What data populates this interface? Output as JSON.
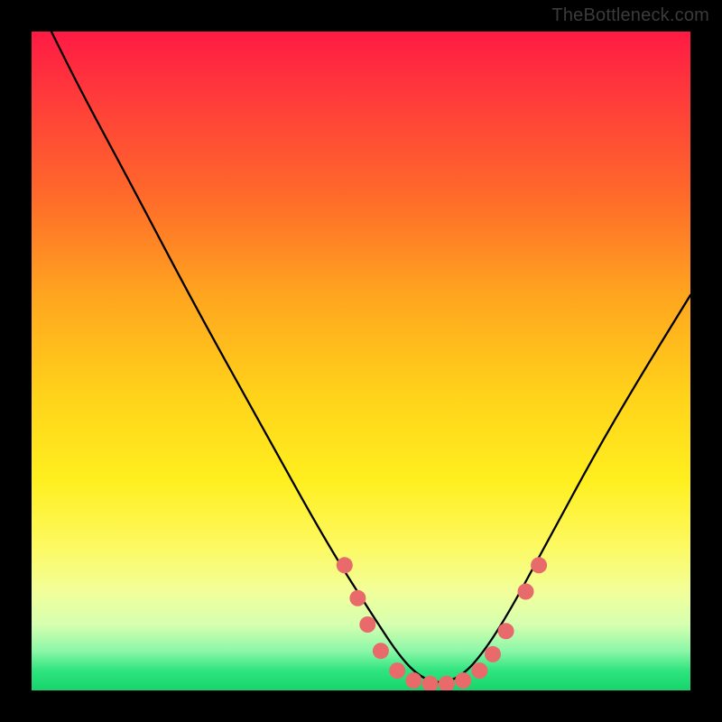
{
  "attribution": "TheBottleneck.com",
  "chart_data": {
    "type": "line",
    "title": "",
    "xlabel": "",
    "ylabel": "",
    "xlim": [
      0,
      100
    ],
    "ylim": [
      0,
      100
    ],
    "grid": false,
    "legend": false,
    "background_gradient": [
      "#ff1a44",
      "#ffd21a",
      "#17d46b"
    ],
    "series": [
      {
        "name": "bottleneck-curve",
        "color": "#000000",
        "x": [
          3,
          8,
          15,
          25,
          35,
          45,
          52,
          56,
          59,
          62,
          65,
          68,
          72,
          78,
          85,
          92,
          100
        ],
        "y": [
          100,
          90,
          77,
          58,
          40,
          22,
          11,
          5,
          2,
          1,
          2,
          5,
          11,
          22,
          35,
          47,
          60
        ]
      }
    ],
    "markers": {
      "name": "highlighted-points",
      "color": "#e86a6a",
      "radius": 9,
      "points": [
        {
          "x": 47.5,
          "y": 19
        },
        {
          "x": 49.5,
          "y": 14
        },
        {
          "x": 51,
          "y": 10
        },
        {
          "x": 53,
          "y": 6
        },
        {
          "x": 55.5,
          "y": 3
        },
        {
          "x": 58,
          "y": 1.5
        },
        {
          "x": 60.5,
          "y": 1
        },
        {
          "x": 63,
          "y": 1
        },
        {
          "x": 65.5,
          "y": 1.5
        },
        {
          "x": 68,
          "y": 3
        },
        {
          "x": 70,
          "y": 5.5
        },
        {
          "x": 72,
          "y": 9
        },
        {
          "x": 75,
          "y": 15
        },
        {
          "x": 77,
          "y": 19
        }
      ]
    }
  }
}
